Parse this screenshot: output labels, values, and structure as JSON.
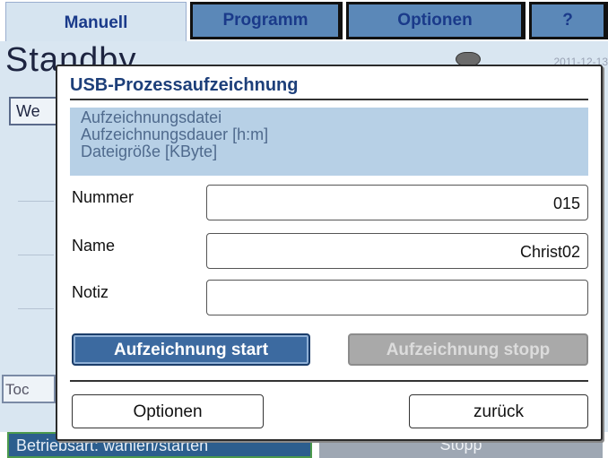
{
  "tabs": [
    {
      "label": "Manuell",
      "active": true
    },
    {
      "label": "Programm",
      "active": false
    },
    {
      "label": "Optionen",
      "active": false
    },
    {
      "label": "?",
      "active": false
    }
  ],
  "background": {
    "title": "Standby",
    "date": "2011-12-13",
    "w_button": "We",
    "toc_button": "Toc",
    "bottom_left": "Betriebsart: wählen/starten",
    "bottom_right": "Stopp"
  },
  "dialog": {
    "title": "USB-Prozessaufzeichnung",
    "info_lines": [
      "Aufzeichnungsdatei",
      "Aufzeichnungsdauer [h:m]",
      "Dateigröße [KByte]"
    ],
    "fields": {
      "nummer": {
        "label": "Nummer",
        "value": "015"
      },
      "name": {
        "label": "Name",
        "value": "Christ02"
      },
      "notiz": {
        "label": "Notiz",
        "value": ""
      }
    },
    "start_label": "Aufzeichnung start",
    "stop_label": "Aufzeichnung stopp",
    "options_label": "Optionen",
    "back_label": "zurück"
  },
  "colors": {
    "accent": "#3c6aa0",
    "tab_inactive": "#5b88b8",
    "info_panel": "#b7d0e6",
    "disabled": "#a9a9a9"
  }
}
